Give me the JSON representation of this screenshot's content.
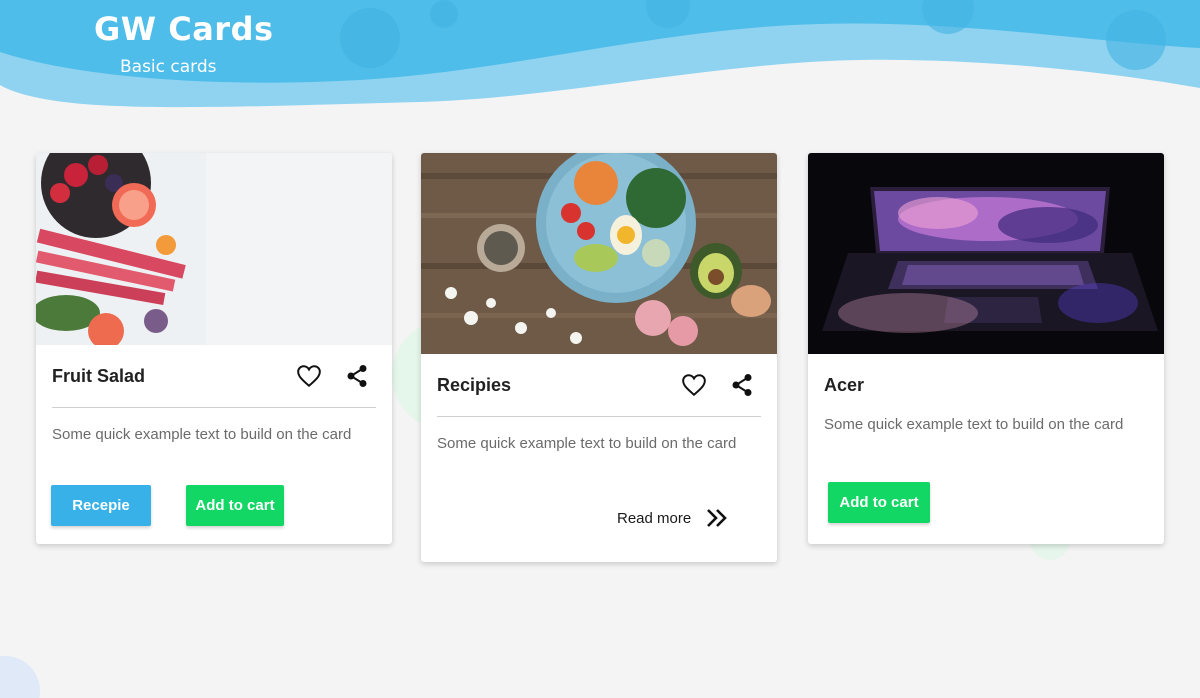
{
  "header": {
    "title": "GW Cards",
    "subtitle": "Basic cards"
  },
  "colors": {
    "header_blue": "#4fbde9",
    "header_light": "#8dd3f1",
    "page_bg": "#f4f4f4",
    "button_blue": "#37b1e7",
    "button_green": "#12d764"
  },
  "cards": [
    {
      "title": "Fruit Salad",
      "text": "Some quick example text to build on the card",
      "icons": [
        "heart-icon",
        "share-icon"
      ],
      "buttons": {
        "primary": "Recepie",
        "secondary": "Add to cart"
      }
    },
    {
      "title": "Recipies",
      "text": "Some quick example text to build on the card",
      "icons": [
        "heart-icon",
        "share-icon"
      ],
      "link": "Read more"
    },
    {
      "title": "Acer",
      "text": "Some quick example text to build on the card",
      "buttons": {
        "secondary": "Add to cart"
      }
    }
  ]
}
